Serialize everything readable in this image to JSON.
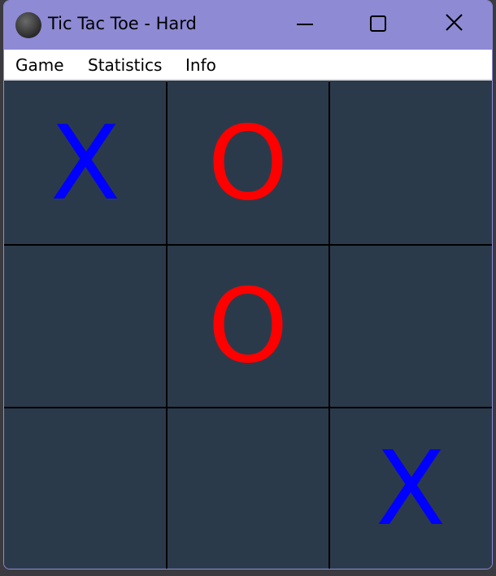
{
  "window": {
    "title": "Tic Tac Toe - Hard",
    "icon": "app-ball-icon",
    "controls": [
      "minimize-icon",
      "maximize-icon",
      "close-icon"
    ]
  },
  "menu": {
    "game": "Game",
    "statistics": "Statistics",
    "info": "Info"
  },
  "board": {
    "rows": [
      [
        "X",
        "O",
        ""
      ],
      [
        "",
        "O",
        ""
      ],
      [
        "",
        "",
        "X"
      ]
    ]
  },
  "colors": {
    "x": "#0000ff",
    "o": "#ff0000",
    "cell": "#2b3a4a",
    "titlebar": "#8e8ad4"
  }
}
